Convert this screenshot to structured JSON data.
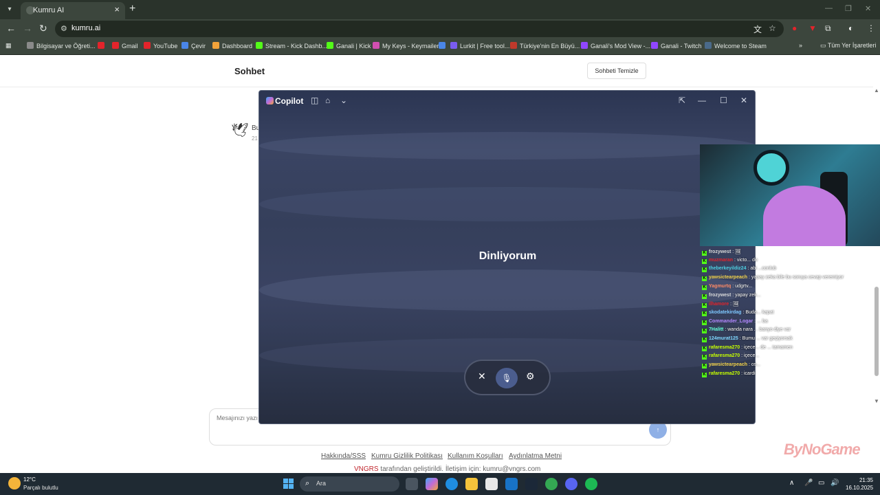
{
  "browser": {
    "tab_title": "Kumru AI",
    "url": "kumru.ai",
    "bookmarks": [
      {
        "label": "Bilgisayar ve Öğreti...",
        "color": "#8a8a8a"
      },
      {
        "label": "",
        "color": "#e3242b"
      },
      {
        "label": "Gmail",
        "color": "#e3242b"
      },
      {
        "label": "YouTube",
        "color": "#e3242b"
      },
      {
        "label": "Çevir",
        "color": "#4a86e8"
      },
      {
        "label": "Dashboard",
        "color": "#f2a33a"
      },
      {
        "label": "Stream - Kick Dashb...",
        "color": "#53fc18"
      },
      {
        "label": "Ganali | Kick",
        "color": "#53fc18"
      },
      {
        "label": "My Keys - Keymailer",
        "color": "#d14fb1"
      },
      {
        "label": "",
        "color": "#4a86e8"
      },
      {
        "label": "Lurkit | Free tool...",
        "color": "#7a5cf0"
      },
      {
        "label": "Türkiye'nin En Büyü...",
        "color": "#c0392b"
      },
      {
        "label": "Ganali's Mod View -...",
        "color": "#9146ff"
      },
      {
        "label": "Ganali - Twitch",
        "color": "#9146ff"
      },
      {
        "label": "Welcome to Steam",
        "color": "#4a6a8a"
      }
    ],
    "all_bookmarks": "Tüm Yer İşaretleri"
  },
  "page": {
    "header_title": "Sohbet",
    "clear_button": "Sohbeti Temizle",
    "bot_name": "Bu",
    "bot_time": "21",
    "composer_placeholder": "Mesajınızı yazı",
    "footer_links": [
      "Hakkında/SSS",
      "Kumru Gizlilik Politikası",
      "Kullanım Koşulları",
      "Aydınlatma Metni"
    ],
    "footer_brand": "VNGRS",
    "footer_text": " tarafından geliştirildi. İletişim için: kumru@vngrs.com"
  },
  "copilot": {
    "title": "Copilot",
    "status": "Dinliyorum"
  },
  "stream_chat": [
    {
      "user": "frozywest",
      "color": "#d9d9d9",
      "text": "🖼"
    },
    {
      "user": "muzmaran",
      "color": "#e3242b",
      "text": "victo... do"
    },
    {
      "user": "theberkeyildiz24",
      "color": "#4dd0e1",
      "text": "abi ...conlub"
    },
    {
      "user": "yawsictearpeach",
      "color": "#f3d34a",
      "text": "yapay zeka bile bu soruya cevap veremiyor"
    },
    {
      "user": "Yagmurtq",
      "color": "#ff8a65",
      "text": "udgrtv..."
    },
    {
      "user": "frozywest",
      "color": "#d9d9d9",
      "text": "yapay zek..."
    },
    {
      "user": "ilhamore",
      "color": "#e3242b",
      "text": "🖼"
    },
    {
      "user": "skodatekirdag",
      "color": "#7ec8ff",
      "text": "Buda... kapat"
    },
    {
      "user": "Commander_Logar",
      "color": "#b388ff",
      "text": "... ba"
    },
    {
      "user": "7Halitt",
      "color": "#64ffda",
      "text": "wanda nara ... banyo diye var"
    },
    {
      "user": "124murat125",
      "color": "#80d8ff",
      "text": "Bumu ... var geçiyorsak"
    },
    {
      "user": "rafaresma270",
      "color": "#c6ff00",
      "text": "içece... de ... tamamen"
    },
    {
      "user": "rafaresma270",
      "color": "#c6ff00",
      "text": "içece..."
    },
    {
      "user": "yawsictearpeach",
      "color": "#f3d34a",
      "text": "os..."
    },
    {
      "user": "rafaresma270",
      "color": "#c6ff00",
      "text": "icardi"
    }
  ],
  "watermark": "ByNoGame",
  "taskbar": {
    "temp": "12°C",
    "weather": "Parçalı bulutlu",
    "search_placeholder": "Ara",
    "time": "21:35",
    "date": "16.10.2025"
  }
}
